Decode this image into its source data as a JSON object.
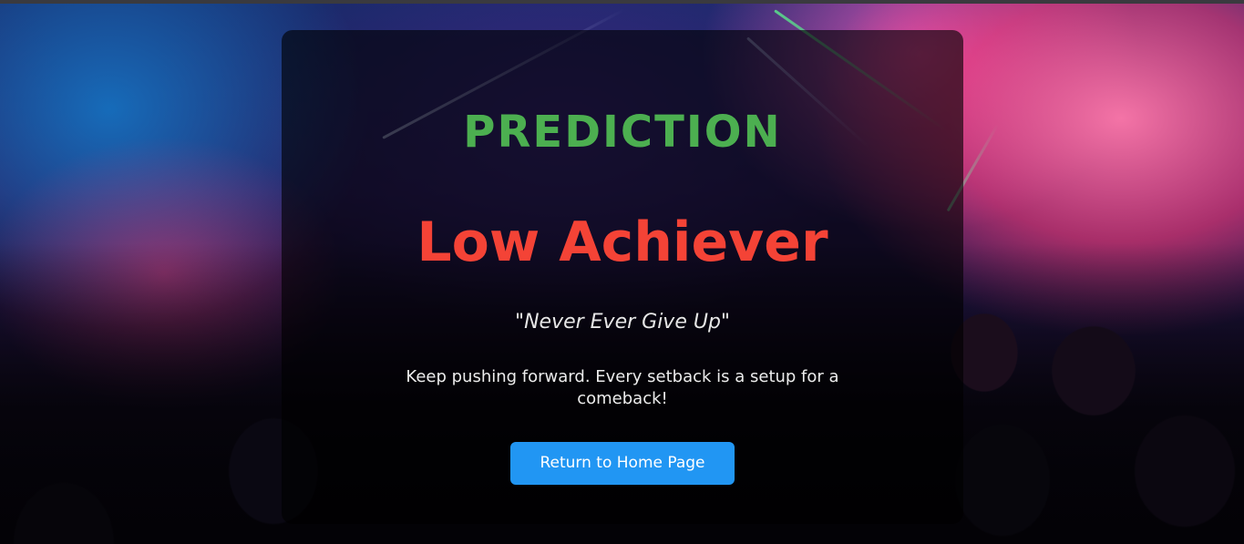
{
  "result": {
    "label": "PREDICTION",
    "prediction": "Low Achiever",
    "quote": "\"Never Ever Give Up\"",
    "message": "Keep pushing forward. Every setback is a setup for a comeback!",
    "button_label": "Return to Home Page"
  },
  "colors": {
    "label": "#4caf50",
    "prediction": "#f44336",
    "button": "#2196f3",
    "card_overlay": "rgba(0,0,0,0.62)"
  }
}
